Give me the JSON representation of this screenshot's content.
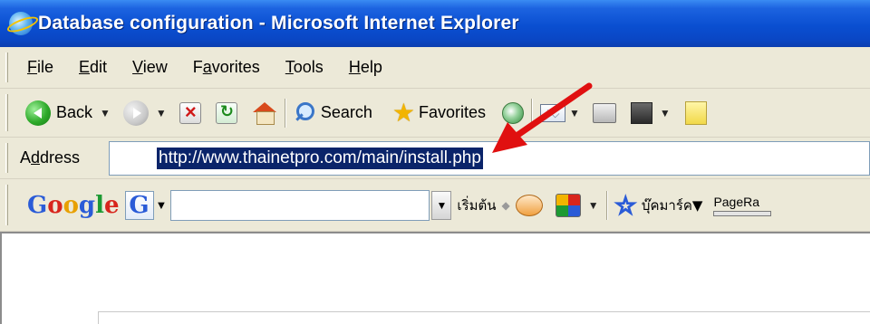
{
  "window": {
    "title": "Database configuration - Microsoft Internet Explorer"
  },
  "menu": {
    "items": [
      {
        "label": "File",
        "key": "F",
        "rest": "ile"
      },
      {
        "label": "Edit",
        "key": "E",
        "rest": "dit"
      },
      {
        "label": "View",
        "key": "V",
        "rest": "iew"
      },
      {
        "label": "Favorites",
        "key": "",
        "pre": "F",
        "u": "a",
        "rest": "vorites"
      },
      {
        "label": "Tools",
        "key": "T",
        "rest": "ools"
      },
      {
        "label": "Help",
        "key": "H",
        "rest": "elp"
      }
    ],
    "favorites_pre": "F",
    "favorites_key": "a",
    "favorites_rest": "vorites"
  },
  "toolbar": {
    "back_label": "Back",
    "search_label": "Search",
    "favorites_label": "Favorites"
  },
  "address": {
    "label_pre": "A",
    "label_key": "d",
    "label_rest": "dress",
    "url": "http://www.thainetpro.com/main/install.php"
  },
  "google": {
    "logo": [
      "G",
      "o",
      "o",
      "g",
      "l",
      "e"
    ],
    "g_button": "G",
    "start_label": "เริ่มต้น",
    "bookmarks_label": "บุ๊คมาร์ค",
    "pagerank_label": "PageRa"
  },
  "colors": {
    "title_bar": "#0a4fd1",
    "selection": "#0a246a",
    "arrow": "#e01010",
    "chrome": "#ece9d8"
  }
}
